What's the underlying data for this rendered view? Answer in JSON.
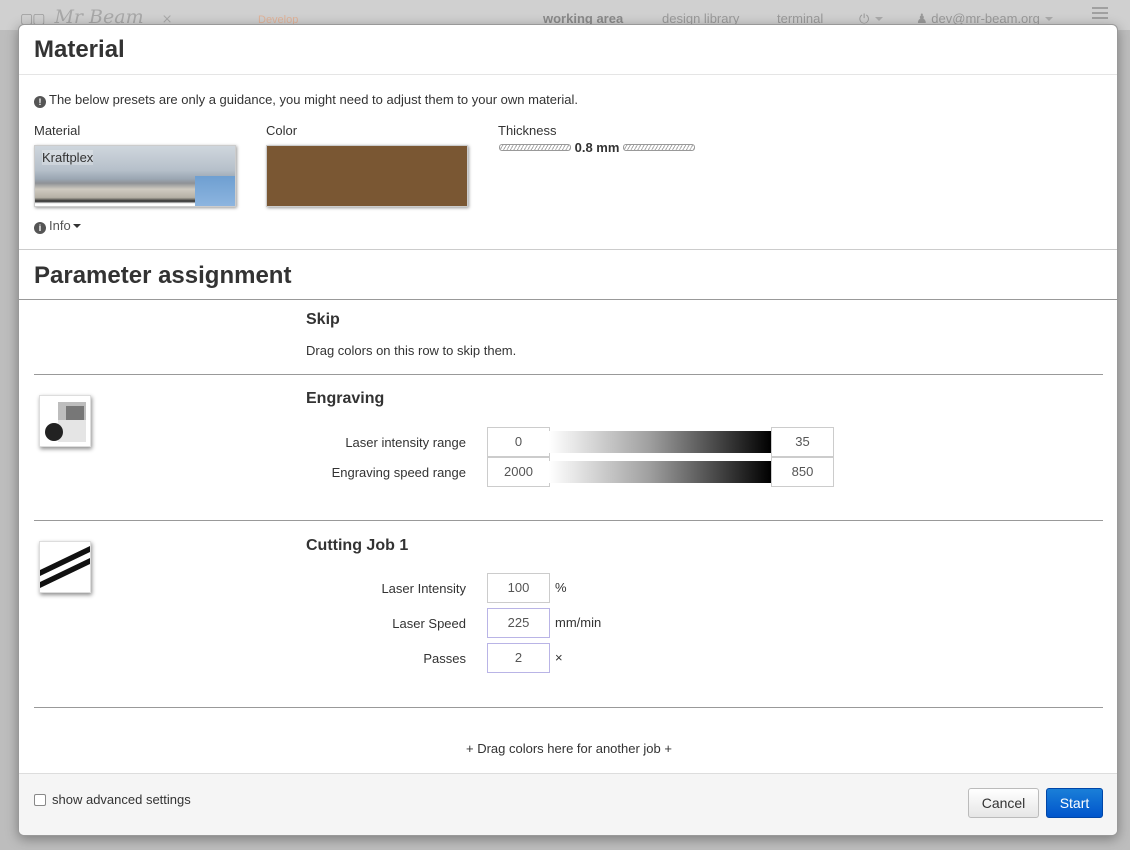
{
  "topbar": {
    "logo_text": "Mr Beam",
    "glasses": "▢▢",
    "close_glyph": "×",
    "version": "Develop",
    "nav": [
      "working area",
      "design library",
      "terminal"
    ],
    "power_glyph": "⏻",
    "user": "dev@mr-beam.org"
  },
  "modal": {
    "title": "Material",
    "notice": "The below presets are only a guidance, you might need to adjust them to your own material.",
    "material_label": "Material",
    "material_value": "Kraftplex",
    "color_label": "Color",
    "color_value": "#7a5733",
    "thickness_label": "Thickness",
    "thickness_value": "0.8 mm",
    "info_label": "Info",
    "section_title": "Parameter assignment",
    "skip": {
      "title": "Skip",
      "description": "Drag colors on this row to skip them."
    },
    "engraving": {
      "title": "Engraving",
      "intensity_label": "Laser intensity range",
      "intensity_min": "0",
      "intensity_max": "35",
      "speed_label": "Engraving speed range",
      "speed_min": "2000",
      "speed_max": "850"
    },
    "cutting": {
      "title": "Cutting Job 1",
      "intensity_label": "Laser Intensity",
      "intensity_value": "100",
      "intensity_unit": "%",
      "speed_label": "Laser Speed",
      "speed_value": "225",
      "speed_unit": "mm/min",
      "passes_label": "Passes",
      "passes_value": "2",
      "passes_unit": "×"
    },
    "drag_hint": "+ Drag colors here for another job +",
    "advanced_label": "show advanced settings",
    "cancel_label": "Cancel",
    "start_label": "Start"
  },
  "colors": {
    "primary": "#0066cc",
    "material_color": "#7a5733"
  }
}
